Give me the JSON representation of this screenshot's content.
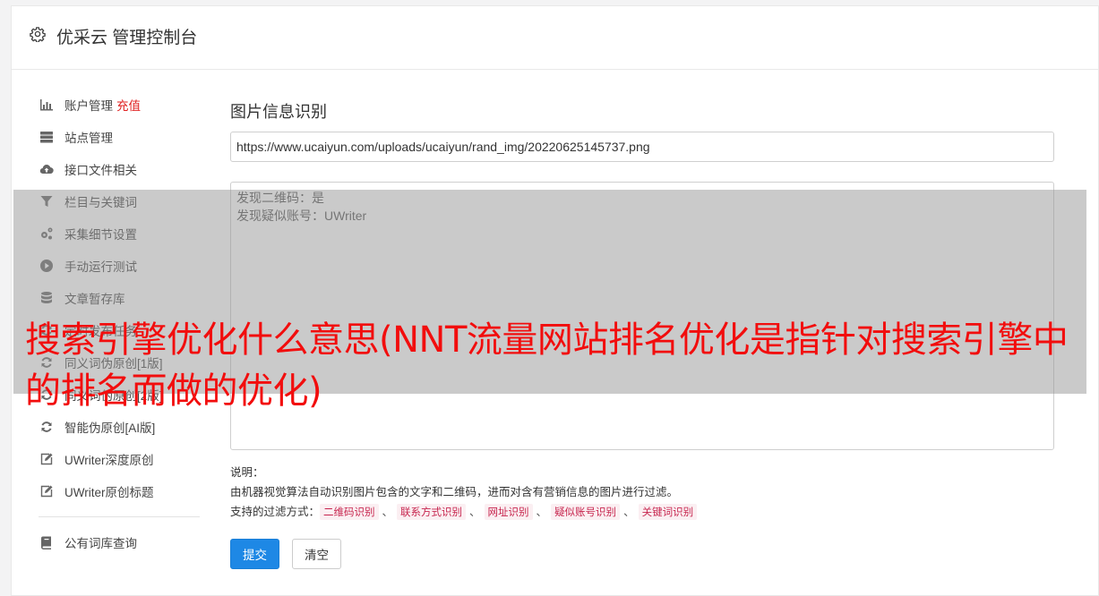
{
  "header": {
    "title": "优采云 管理控制台",
    "icon": "gear-icon"
  },
  "sidebar": {
    "items": [
      {
        "label": "账户管理",
        "extra": "充值",
        "icon": "bar-chart-icon"
      },
      {
        "label": "站点管理",
        "icon": "server-icon"
      },
      {
        "label": "接口文件相关",
        "icon": "cloud-upload-icon"
      },
      {
        "label": "栏目与关键词",
        "icon": "filter-icon"
      },
      {
        "label": "采集细节设置",
        "icon": "gears-icon"
      },
      {
        "label": "手动运行测试",
        "icon": "play-circle-icon"
      },
      {
        "label": "文章暂存库",
        "icon": "database-icon"
      },
      {
        "label": "定时发布任务",
        "icon": "refresh-icon"
      },
      {
        "label": "同义词伪原创[1版]",
        "icon": "refresh-icon"
      },
      {
        "label": "同义词伪原创[2版]",
        "icon": "refresh-icon"
      },
      {
        "label": "智能伪原创[AI版]",
        "icon": "refresh-icon"
      },
      {
        "label": "UWriter深度原创",
        "icon": "edit-icon"
      },
      {
        "label": "UWriter原创标题",
        "icon": "edit-icon"
      }
    ],
    "bottom_items": [
      {
        "label": "公有词库查询",
        "icon": "book-icon"
      }
    ]
  },
  "main": {
    "title": "图片信息识别",
    "url_value": "https://www.ucaiyun.com/uploads/ucaiyun/rand_img/20220625145737.png",
    "result_lines": [
      "发现二维码：是",
      "发现疑似账号：UWriter"
    ],
    "notes_label": "说明：",
    "notes_desc": "由机器视觉算法自动识别图片包含的文字和二维码，进而对含有营销信息的图片进行过滤。",
    "filter_label": "支持的过滤方式：",
    "filter_tags": [
      "二维码识别",
      "联系方式识别",
      "网址识别",
      "疑似账号识别",
      "关键词识别"
    ],
    "filter_sep": "、",
    "submit_label": "提交",
    "clear_label": "清空"
  },
  "overlay": {
    "headline": "搜索引擎优化什么意思(NNT流量网站排名优化是指针对搜索引擎中的排名而做的优化)"
  },
  "colors": {
    "accent": "#1e88e5",
    "recharge": "#e02020",
    "overlay_text": "#f20d0d",
    "tag_text": "#c7254e"
  }
}
